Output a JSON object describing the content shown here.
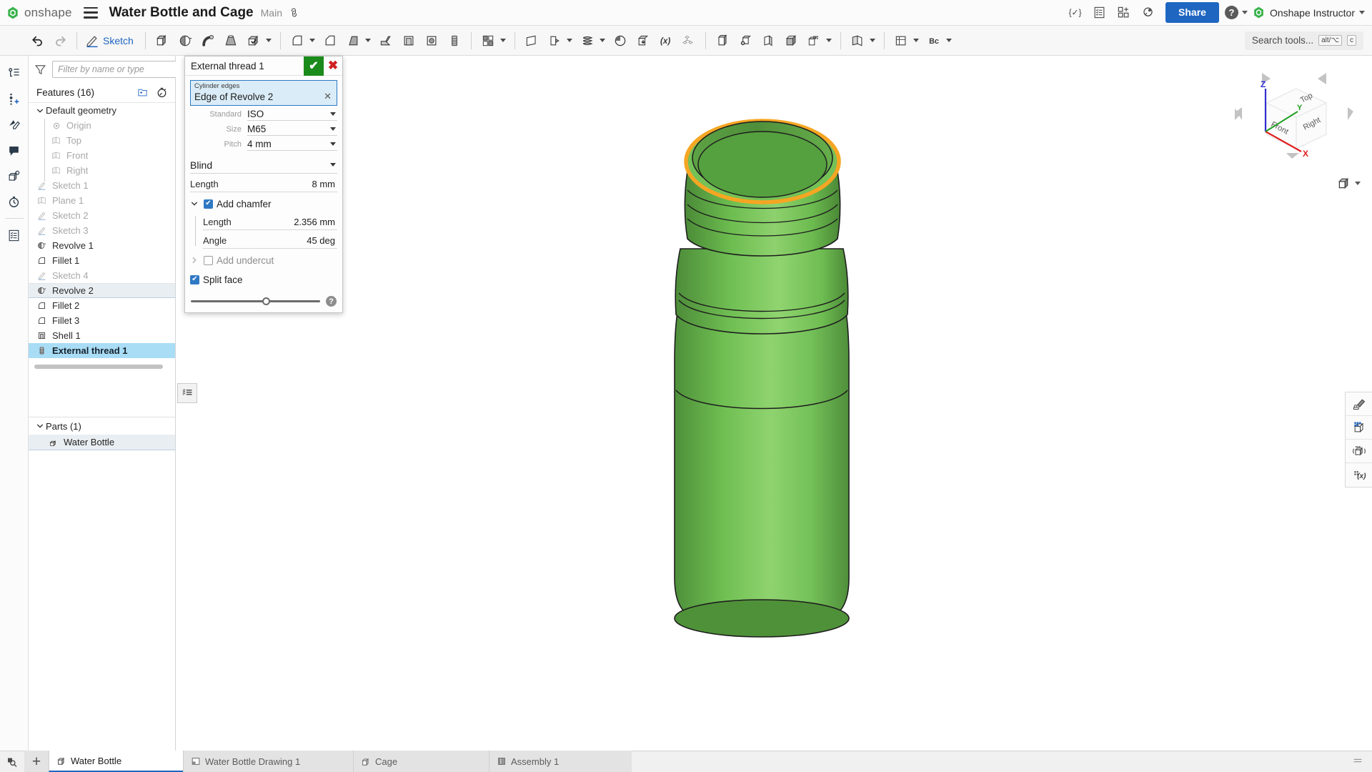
{
  "header": {
    "brand": "onshape",
    "brand_logo_icon": "onshape-logo-icon",
    "menu_icon": "hamburger-menu-icon",
    "doc_title": "Water Bottle and Cage",
    "branch": "Main",
    "link_icon": "link-icon",
    "right_icons": [
      {
        "name": "featurescript-icon",
        "glyph": "{✓}"
      },
      {
        "name": "release-candidate-icon",
        "glyph": "▤"
      },
      {
        "name": "app-store-icon",
        "glyph": "▦"
      },
      {
        "name": "insights-icon",
        "glyph": "◉"
      }
    ],
    "share_label": "Share",
    "help_glyph": "?",
    "user_name": "Onshape Instructor",
    "user_logo_icon": "onshape-avatar-icon"
  },
  "toolbar": {
    "undo_icon": "undo-icon",
    "redo_icon": "redo-icon",
    "sketch_label": "Sketch",
    "sketch_icon": "sketch-pencil-icon",
    "items": [
      {
        "name": "extrude-icon"
      },
      {
        "name": "revolve-icon"
      },
      {
        "name": "sweep-icon"
      },
      {
        "name": "loft-icon"
      },
      {
        "name": "boolean-icon",
        "caret": true
      },
      {
        "name": "fillet-icon",
        "caret": true
      },
      {
        "name": "chamfer-icon"
      },
      {
        "name": "draft-icon",
        "caret": true
      },
      {
        "name": "rib-icon"
      },
      {
        "name": "shell-icon"
      },
      {
        "name": "hole-icon"
      },
      {
        "name": "thread-icon"
      },
      {
        "name": "pattern-icon",
        "caret": true
      },
      {
        "name": "plane-icon"
      },
      {
        "name": "transform-icon",
        "caret": true
      },
      {
        "name": "helix-icon",
        "caret": true
      },
      {
        "name": "split-icon"
      },
      {
        "name": "import-derived-icon"
      },
      {
        "name": "variable-icon",
        "glyph": "(x)"
      },
      {
        "name": "assembly-parts-icon"
      },
      {
        "name": "part-studio-icon"
      },
      {
        "name": "delete-part-icon"
      },
      {
        "name": "mirror-icon"
      },
      {
        "name": "solid-cube-icon"
      },
      {
        "name": "composite-part-icon",
        "caret": true
      },
      {
        "name": "sheet-metal-icon",
        "caret": true
      },
      {
        "name": "display-state-icon",
        "caret": true
      },
      {
        "name": "bc-tools-icon",
        "glyph": "Bc",
        "caret": true
      }
    ],
    "search_placeholder": "Search tools...",
    "search_kbd_1": "alt/⌥",
    "search_kbd_2": "c"
  },
  "left_rail": [
    {
      "name": "feature-list-icon"
    },
    {
      "name": "add-version-icon"
    },
    {
      "name": "markup-icon"
    },
    {
      "name": "comments-icon"
    },
    {
      "name": "part-properties-icon"
    },
    {
      "name": "history-icon"
    },
    {
      "name": "bill-of-materials-icon"
    }
  ],
  "tree": {
    "filter_icon": "filter-funnel-icon",
    "filter_placeholder": "Filter by name or type",
    "features_title": "Features (16)",
    "new_folder_icon": "new-folder-icon",
    "rollback-timer_icon": "rollback-timer-icon",
    "items": [
      {
        "label": "Default geometry",
        "icon": "folder-group-icon",
        "state": "normal",
        "indent": 0,
        "chevron": "down"
      },
      {
        "label": "Origin",
        "icon": "origin-icon",
        "state": "dim",
        "indent": 1
      },
      {
        "label": "Top",
        "icon": "plane-icon",
        "state": "dim",
        "indent": 1
      },
      {
        "label": "Front",
        "icon": "plane-icon",
        "state": "dim",
        "indent": 1
      },
      {
        "label": "Right",
        "icon": "plane-icon",
        "state": "dim",
        "indent": 1
      },
      {
        "label": "Sketch 1",
        "icon": "sketch-icon",
        "state": "dim",
        "indent": 0
      },
      {
        "label": "Plane 1",
        "icon": "plane-icon",
        "state": "dim",
        "indent": 0
      },
      {
        "label": "Sketch 2",
        "icon": "sketch-icon",
        "state": "dim",
        "indent": 0
      },
      {
        "label": "Sketch 3",
        "icon": "sketch-icon",
        "state": "dim",
        "indent": 0
      },
      {
        "label": "Revolve 1",
        "icon": "revolve-icon",
        "state": "normal",
        "indent": 0
      },
      {
        "label": "Fillet 1",
        "icon": "fillet-icon",
        "state": "normal",
        "indent": 0
      },
      {
        "label": "Sketch 4",
        "icon": "sketch-icon",
        "state": "dim",
        "indent": 0
      },
      {
        "label": "Revolve 2",
        "icon": "revolve-icon",
        "state": "sel-soft",
        "indent": 0
      },
      {
        "label": "Fillet 2",
        "icon": "fillet-icon",
        "state": "normal",
        "indent": 0
      },
      {
        "label": "Fillet 3",
        "icon": "fillet-icon",
        "state": "normal",
        "indent": 0
      },
      {
        "label": "Shell 1",
        "icon": "shell-icon",
        "state": "normal",
        "indent": 0
      },
      {
        "label": "External thread 1",
        "icon": "thread-icon",
        "state": "sel-strong",
        "indent": 0
      }
    ],
    "parts_title": "Parts (1)",
    "parts": [
      {
        "label": "Water Bottle",
        "icon": "part-icon"
      }
    ],
    "toggle_icon": "tree-list-toggle-icon"
  },
  "dialog": {
    "title": "External thread 1",
    "ok_icon": "checkmark-icon",
    "cancel_icon": "close-x-icon",
    "query_label": "Cylinder edges",
    "query_value": "Edge of Revolve 2",
    "query_clear_icon": "clear-x-icon",
    "fields": [
      {
        "label": "Standard",
        "value": "ISO"
      },
      {
        "label": "Size",
        "value": "M65"
      },
      {
        "label": "Pitch",
        "value": "4 mm"
      }
    ],
    "end_condition": "Blind",
    "length_label": "Length",
    "length_value": "8 mm",
    "add_chamfer_label": "Add chamfer",
    "add_chamfer_checked": true,
    "chamfer_length_label": "Length",
    "chamfer_length_value": "2.356 mm",
    "chamfer_angle_label": "Angle",
    "chamfer_angle_value": "45 deg",
    "add_undercut_label": "Add undercut",
    "add_undercut_checked": false,
    "split_face_label": "Split face",
    "split_face_checked": true,
    "help_glyph": "?"
  },
  "viewport": {
    "model_name": "Water Bottle",
    "model_color": "#6fbf52",
    "model_color_dark": "#4e8f3a",
    "model_color_light": "#8fd36f",
    "highlight_edge_color": "#f5a623",
    "view_cube": {
      "top_label": "Top",
      "front_label": "Front",
      "right_label": "Right",
      "axis_x": "X",
      "axis_y": "Y",
      "axis_z": "Z",
      "axis_x_color": "#e02020",
      "axis_y_color": "#20a020",
      "axis_z_color": "#3030d0"
    },
    "view_mode_icon": "shaded-view-icon",
    "right_tools": [
      {
        "name": "appearance-paint-icon"
      },
      {
        "name": "section-view-icon"
      },
      {
        "name": "render-view-icon"
      },
      {
        "name": "measure-variables-icon"
      }
    ]
  },
  "tabbar": {
    "search_tab_icon": "tab-search-icon",
    "add_tab_glyph": "+",
    "tabs": [
      {
        "label": "Water Bottle",
        "icon": "part-studio-tab-icon",
        "active": true
      },
      {
        "label": "Water Bottle Drawing 1",
        "icon": "drawing-tab-icon",
        "active": false
      },
      {
        "label": "Cage",
        "icon": "part-studio-tab-icon",
        "active": false
      },
      {
        "label": "Assembly 1",
        "icon": "assembly-tab-icon",
        "active": false
      }
    ],
    "collapse_icon": "collapse-tabs-icon"
  }
}
